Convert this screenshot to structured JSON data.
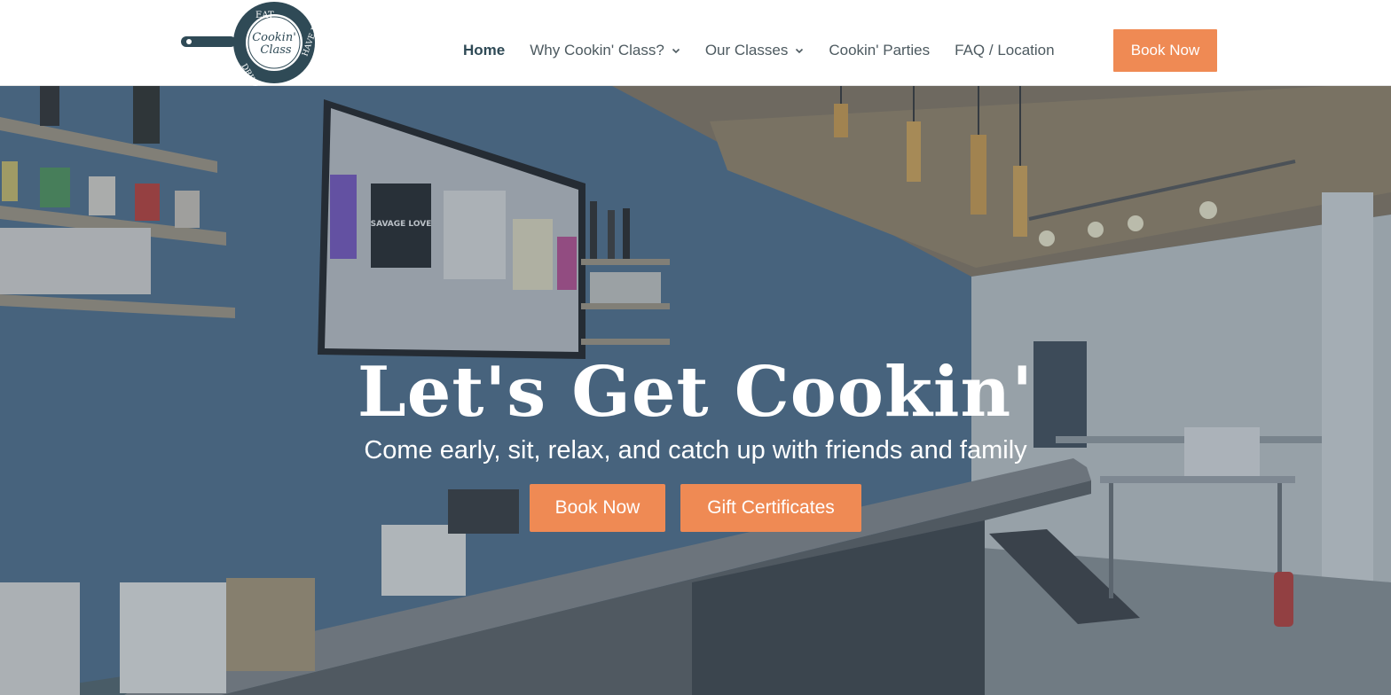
{
  "brand": {
    "logo_text_line1": "Cookin'",
    "logo_text_line2": "Class",
    "logo_ring_top": "EAT",
    "logo_ring_bottom": "DRINK",
    "logo_ring_right": "HAVE FUN",
    "colors": {
      "navy": "#2f4a56",
      "accent": "#ef8a54"
    }
  },
  "nav": {
    "home": "Home",
    "why": "Why Cookin' Class?",
    "classes": "Our Classes",
    "parties": "Cookin' Parties",
    "faq": "FAQ / Location",
    "book": "Book Now"
  },
  "hero": {
    "title": "Let's Get Cookin'",
    "subtitle": "Come early, sit, relax, and catch up with friends and family",
    "book_button": "Book Now",
    "gift_button": "Gift Certificates",
    "tv_album": "SAVAGE LOVE"
  }
}
